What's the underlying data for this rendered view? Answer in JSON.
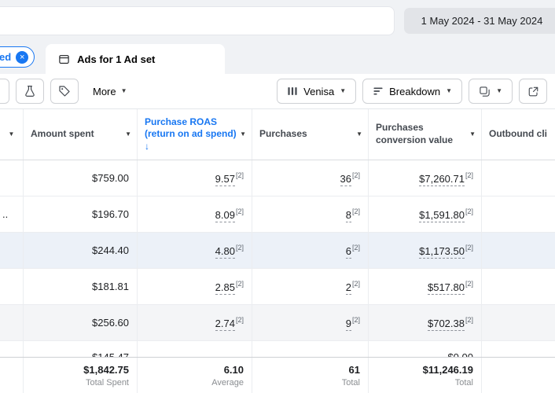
{
  "topbar": {
    "date_range": "1 May 2024 - 31 May 2024"
  },
  "tab_bar": {
    "filter_chip_label": "ed",
    "active_tab_label": "Ads for 1 Ad set"
  },
  "toolbar": {
    "more_label": "More",
    "columns_label": "Venisa",
    "breakdown_label": "Breakdown"
  },
  "icons": {
    "caret": "▼",
    "close": "×"
  },
  "table": {
    "footnote": "[2]",
    "headers": {
      "amount_spent": "Amount spent",
      "purchase_roas": "Purchase ROAS (return on ad spend) ↓",
      "purchases": "Purchases",
      "conversion_value": "Purchases conversion value",
      "outbound": "Outbound cli"
    },
    "rows": [
      {
        "name_fragment": "",
        "amount": "$759.00",
        "roas": "9.57",
        "purchases": "36",
        "conv": "$7,260.71"
      },
      {
        "name_fragment": "..",
        "amount": "$196.70",
        "roas": "8.09",
        "purchases": "8",
        "conv": "$1,591.80"
      },
      {
        "name_fragment": "",
        "amount": "$244.40",
        "roas": "4.80",
        "purchases": "6",
        "conv": "$1,173.50"
      },
      {
        "name_fragment": "",
        "amount": "$181.81",
        "roas": "2.85",
        "purchases": "2",
        "conv": "$517.80"
      },
      {
        "name_fragment": "",
        "amount": "$256.60",
        "roas": "2.74",
        "purchases": "9",
        "conv": "$702.38"
      }
    ],
    "partial_row": {
      "amount": "$145.47",
      "conv": "$0.00"
    },
    "totals": {
      "amount": "$1,842.75",
      "amount_caption": "Total Spent",
      "roas": "6.10",
      "roas_caption": "Average",
      "purchases": "61",
      "purchases_caption": "Total",
      "conv": "$11,246.19",
      "conv_caption": "Total"
    }
  },
  "colors": {
    "accent_blue": "#1877f2",
    "background_gray": "#f0f2f5",
    "row_highlight": "#ecf1f8"
  }
}
